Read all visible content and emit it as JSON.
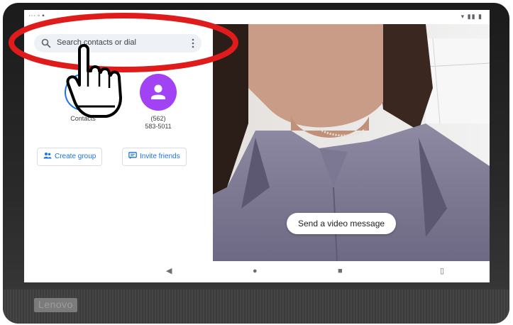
{
  "device": {
    "brand": "Lenovo"
  },
  "search": {
    "placeholder": "Search contacts or dial"
  },
  "contacts": {
    "tiles": [
      {
        "label": "Contacts"
      },
      {
        "label_line1": "(562)",
        "label_line2": "583-5011"
      }
    ]
  },
  "actions": {
    "create_group": "Create group",
    "invite_friends": "Invite friends"
  },
  "video": {
    "send_message": "Send a video message"
  },
  "colors": {
    "accent": "#1a73e8",
    "avatar": "#a142f4",
    "annotation_ring": "#e01b1b"
  },
  "icons": [
    "search-icon",
    "more-vert-icon",
    "person-icon",
    "group-icon",
    "message-icon",
    "back-icon",
    "home-icon",
    "recents-icon",
    "pointing-hand-icon"
  ]
}
